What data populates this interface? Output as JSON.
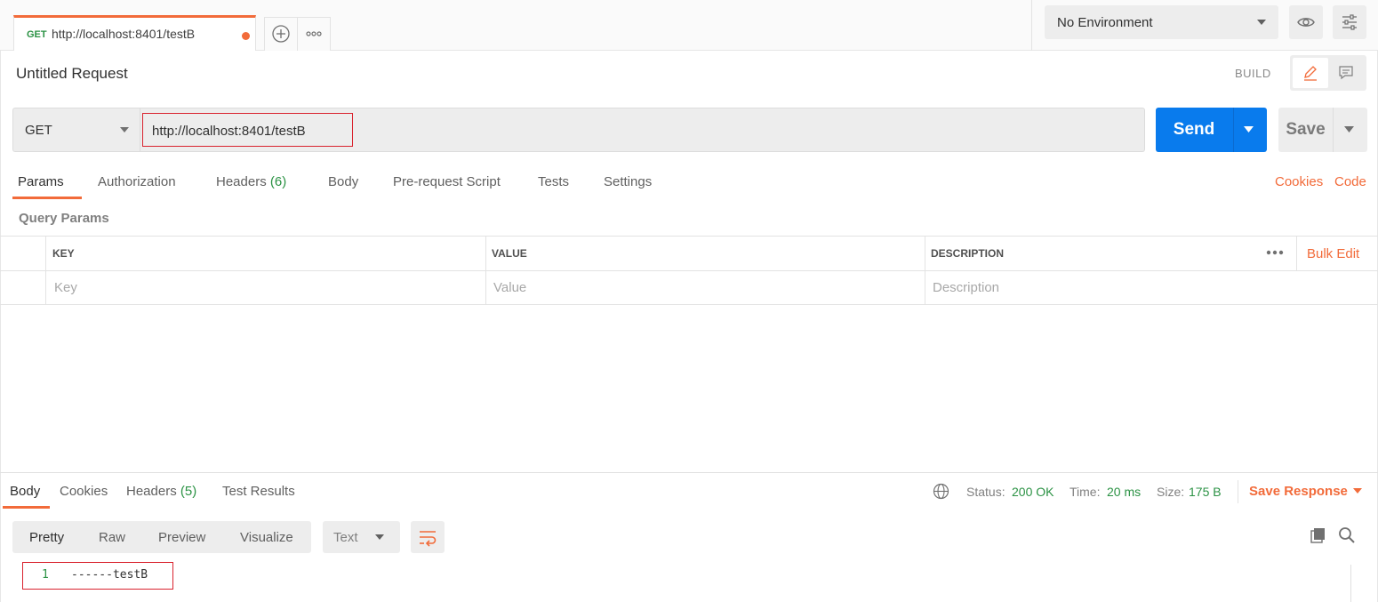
{
  "tab": {
    "method": "GET",
    "url": "http://localhost:8401/testB"
  },
  "environment": {
    "selected": "No Environment"
  },
  "request": {
    "title": "Untitled Request",
    "mode_label": "BUILD",
    "method": "GET",
    "url": "http://localhost:8401/testB",
    "send_label": "Send",
    "save_label": "Save"
  },
  "request_tabs": {
    "params": "Params",
    "authorization": "Authorization",
    "headers": "Headers",
    "headers_count": "(6)",
    "body": "Body",
    "pre_request": "Pre-request Script",
    "tests": "Tests",
    "settings": "Settings",
    "cookies": "Cookies",
    "code": "Code"
  },
  "query_params": {
    "title": "Query Params",
    "columns": [
      "KEY",
      "VALUE",
      "DESCRIPTION"
    ],
    "bulk_edit": "Bulk Edit",
    "placeholders": [
      "Key",
      "Value",
      "Description"
    ]
  },
  "response": {
    "tabs": {
      "body": "Body",
      "cookies": "Cookies",
      "headers": "Headers",
      "headers_count": "(5)",
      "test_results": "Test Results"
    },
    "status_label": "Status:",
    "status_value": "200 OK",
    "time_label": "Time:",
    "time_value": "20 ms",
    "size_label": "Size:",
    "size_value": "175 B",
    "save_response": "Save Response",
    "formats": [
      "Pretty",
      "Raw",
      "Preview",
      "Visualize"
    ],
    "content_type": "Text",
    "lines": [
      {
        "num": "1",
        "text": "------testB"
      }
    ]
  },
  "colors": {
    "accent": "#f26b3a",
    "send": "#097bed",
    "success": "#2b9244",
    "highlight": "#d9232e"
  }
}
